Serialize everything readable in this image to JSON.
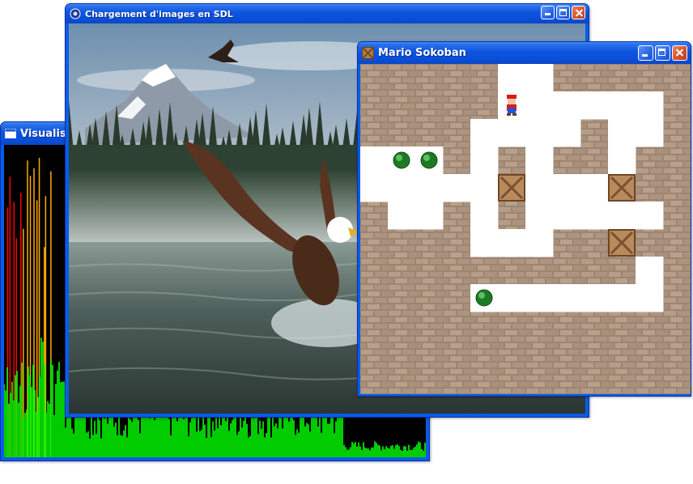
{
  "windows": {
    "visualisation": {
      "title": "Visualisat",
      "background_color": "#000000",
      "spectrum_colors": [
        "#ff0000",
        "#ffaa00",
        "#00ff00"
      ],
      "icon": "window-icon"
    },
    "sdl_loader": {
      "title": "Chargement d'images en SDL",
      "icon": "sdl-app-icon",
      "image_subject": "eagle-over-lake-mountains"
    },
    "sokoban": {
      "title": "Mario Sokoban",
      "icon": "crate-icon",
      "grid": {
        "cols": 12,
        "rows": 12,
        "floor_cells": [
          [
            5,
            0
          ],
          [
            6,
            0
          ],
          [
            5,
            1
          ],
          [
            6,
            1
          ],
          [
            7,
            1
          ],
          [
            8,
            1
          ],
          [
            9,
            1
          ],
          [
            10,
            1
          ],
          [
            4,
            2
          ],
          [
            5,
            2
          ],
          [
            6,
            2
          ],
          [
            7,
            2
          ],
          [
            9,
            2
          ],
          [
            10,
            2
          ],
          [
            0,
            3
          ],
          [
            1,
            3
          ],
          [
            2,
            3
          ],
          [
            4,
            3
          ],
          [
            6,
            3
          ],
          [
            9,
            3
          ],
          [
            0,
            4
          ],
          [
            1,
            4
          ],
          [
            2,
            4
          ],
          [
            3,
            4
          ],
          [
            4,
            4
          ],
          [
            6,
            4
          ],
          [
            7,
            4
          ],
          [
            8,
            4
          ],
          [
            1,
            5
          ],
          [
            2,
            5
          ],
          [
            4,
            5
          ],
          [
            6,
            5
          ],
          [
            7,
            5
          ],
          [
            8,
            5
          ],
          [
            9,
            5
          ],
          [
            10,
            5
          ],
          [
            4,
            6
          ],
          [
            5,
            6
          ],
          [
            6,
            6
          ],
          [
            10,
            7
          ],
          [
            4,
            8
          ],
          [
            5,
            8
          ],
          [
            6,
            8
          ],
          [
            7,
            8
          ],
          [
            8,
            8
          ],
          [
            9,
            8
          ],
          [
            10,
            8
          ]
        ],
        "player": [
          5,
          1
        ],
        "boxes": [
          [
            5,
            4
          ],
          [
            9,
            4
          ],
          [
            9,
            6
          ]
        ],
        "goals": [
          [
            1,
            3
          ],
          [
            2,
            3
          ],
          [
            4,
            8
          ]
        ]
      }
    }
  }
}
